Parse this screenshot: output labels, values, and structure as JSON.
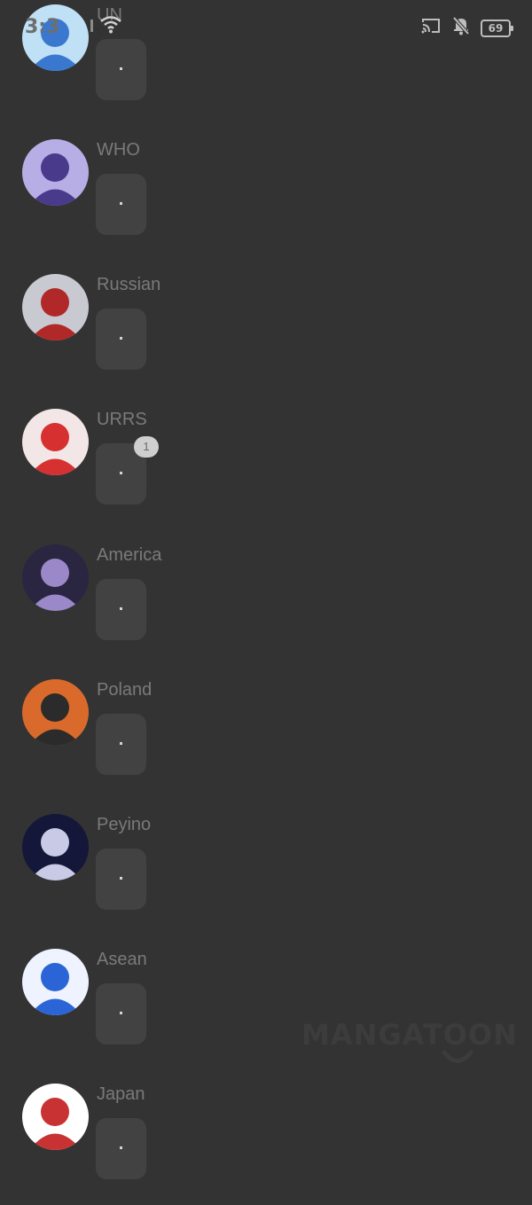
{
  "status_bar": {
    "time": "3:3",
    "battery_level": "69"
  },
  "chats": [
    {
      "name": "UN",
      "message": ".",
      "badge": "",
      "colors": [
        "#bfe0f5",
        "#3a78d0"
      ]
    },
    {
      "name": "WHO",
      "message": ".",
      "badge": "",
      "colors": [
        "#b7aee6",
        "#4a3a8c"
      ]
    },
    {
      "name": "Russian",
      "message": ".",
      "badge": "",
      "colors": [
        "#c9c9d2",
        "#b02828"
      ]
    },
    {
      "name": "URRS",
      "message": ".",
      "badge": "1",
      "colors": [
        "#f3e6e6",
        "#d63030"
      ]
    },
    {
      "name": "America",
      "message": ".",
      "badge": "",
      "colors": [
        "#2a2540",
        "#9a88c8"
      ]
    },
    {
      "name": "Poland",
      "message": ".",
      "badge": "",
      "colors": [
        "#d96a2c",
        "#2b2b2b"
      ]
    },
    {
      "name": "Peyino",
      "message": ".",
      "badge": "",
      "colors": [
        "#14163a",
        "#c9cbe6"
      ]
    },
    {
      "name": "Asean",
      "message": ".",
      "badge": "",
      "colors": [
        "#eef3ff",
        "#2b64d6"
      ]
    },
    {
      "name": "Japan",
      "message": ".",
      "badge": "",
      "colors": [
        "#ffffff",
        "#c83232"
      ]
    }
  ],
  "watermark": {
    "text": "MANGATOON"
  }
}
